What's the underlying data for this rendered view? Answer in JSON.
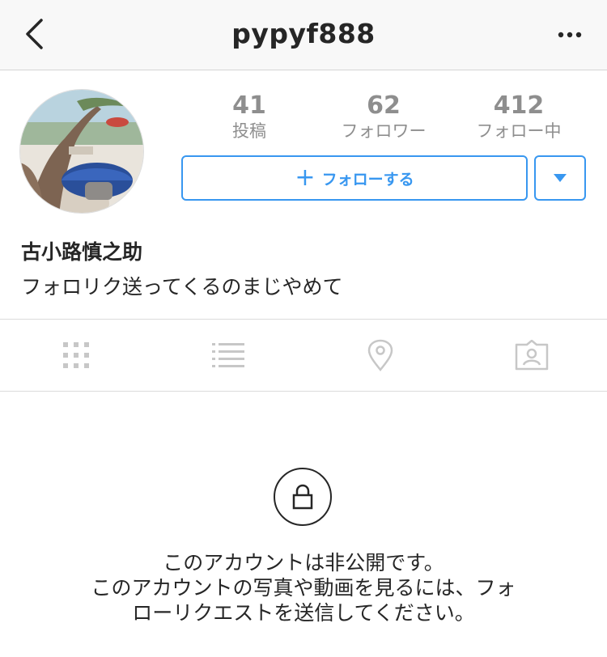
{
  "header": {
    "username": "pypyf888"
  },
  "profile": {
    "stats": {
      "posts_count": "41",
      "posts_label": "投稿",
      "followers_count": "62",
      "followers_label": "フォロワー",
      "following_count": "412",
      "following_label": "フォロー中"
    },
    "follow_button": {
      "icon": "plus-icon",
      "label": "フォローする"
    },
    "suggestions_toggle_icon": "triangle-down-icon",
    "full_name": "古小路慎之助",
    "bio": "フォロリク送ってくるのまじやめて"
  },
  "tabs": [
    {
      "icon": "grid-icon"
    },
    {
      "icon": "list-icon"
    },
    {
      "icon": "location-pin-icon"
    },
    {
      "icon": "tagged-person-icon"
    }
  ],
  "private_notice": {
    "icon": "lock-icon",
    "title": "このアカウントは非公開です。",
    "line1": "このアカウントの写真や動画を見るには、フォ",
    "line2": "ローリクエストを送信してください。"
  },
  "colors": {
    "accent": "#3897f0",
    "muted_text": "#8e8e8e",
    "text": "#262626",
    "navbar_bg": "#f8f8f8"
  }
}
